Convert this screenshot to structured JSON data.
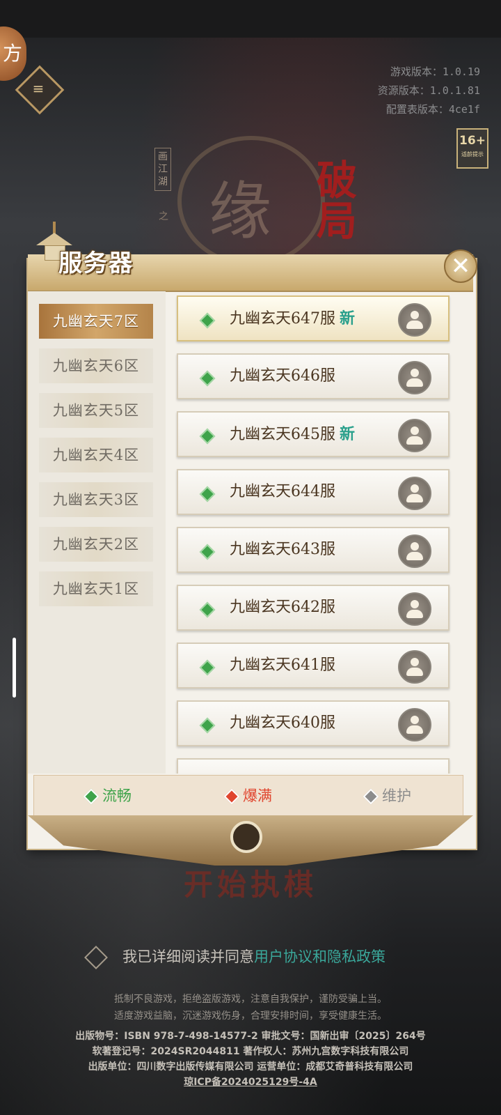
{
  "header": {
    "corner_char": "方",
    "version_lines": [
      "游戏版本：1.0.19",
      "资源版本：1.0.1.81",
      "配置表版本：4ce1f"
    ],
    "age_rating": "16+",
    "age_tip": "适龄提示"
  },
  "logo": {
    "tag": "画江湖",
    "zhi": "之",
    "red_text": "破局",
    "brush": "缘"
  },
  "panel": {
    "title": "服务器",
    "close_symbol": "✕"
  },
  "zones": [
    {
      "label": "九幽玄天7区",
      "active": true
    },
    {
      "label": "九幽玄天6区",
      "active": false
    },
    {
      "label": "九幽玄天5区",
      "active": false
    },
    {
      "label": "九幽玄天4区",
      "active": false
    },
    {
      "label": "九幽玄天3区",
      "active": false
    },
    {
      "label": "九幽玄天2区",
      "active": false
    },
    {
      "label": "九幽玄天1区",
      "active": false
    }
  ],
  "servers": [
    {
      "name": "九幽玄天647服",
      "badge": "新",
      "status": "流畅"
    },
    {
      "name": "九幽玄天646服",
      "badge": "",
      "status": "流畅"
    },
    {
      "name": "九幽玄天645服",
      "badge": "新",
      "status": "流畅"
    },
    {
      "name": "九幽玄天644服",
      "badge": "",
      "status": "流畅"
    },
    {
      "name": "九幽玄天643服",
      "badge": "",
      "status": "流畅"
    },
    {
      "name": "九幽玄天642服",
      "badge": "",
      "status": "流畅"
    },
    {
      "name": "九幽玄天641服",
      "badge": "",
      "status": "流畅"
    },
    {
      "name": "九幽玄天640服",
      "badge": "",
      "status": "流畅"
    }
  ],
  "legend": {
    "smooth": "流畅",
    "full": "爆满",
    "maintenance": "维护",
    "colors": {
      "smooth": "#3ea34a",
      "full": "#e0452e",
      "maintenance": "#8c8c8c"
    }
  },
  "start_button": "开始执棋",
  "agreement": {
    "prefix": "我已详细阅读并同意",
    "link": "用户协议和隐私政策"
  },
  "footer": {
    "notice1": "抵制不良游戏，拒绝盗版游戏，注意自我保护，谨防受骗上当。",
    "notice2": "适度游戏益脑，沉迷游戏伤身，合理安排时间，享受健康生活。",
    "line1": "出版物号：ISBN 978-7-498-14577-2  审批文号：国新出审〔2025〕264号",
    "line2": "软著登记号：2024SR2044811  著作权人：苏州九宫数字科技有限公司",
    "line3": "出版单位：四川数字出版传媒有限公司 运营单位：成都艾奇普科技有限公司",
    "icp": "琼ICP备2024025129号-4A"
  }
}
